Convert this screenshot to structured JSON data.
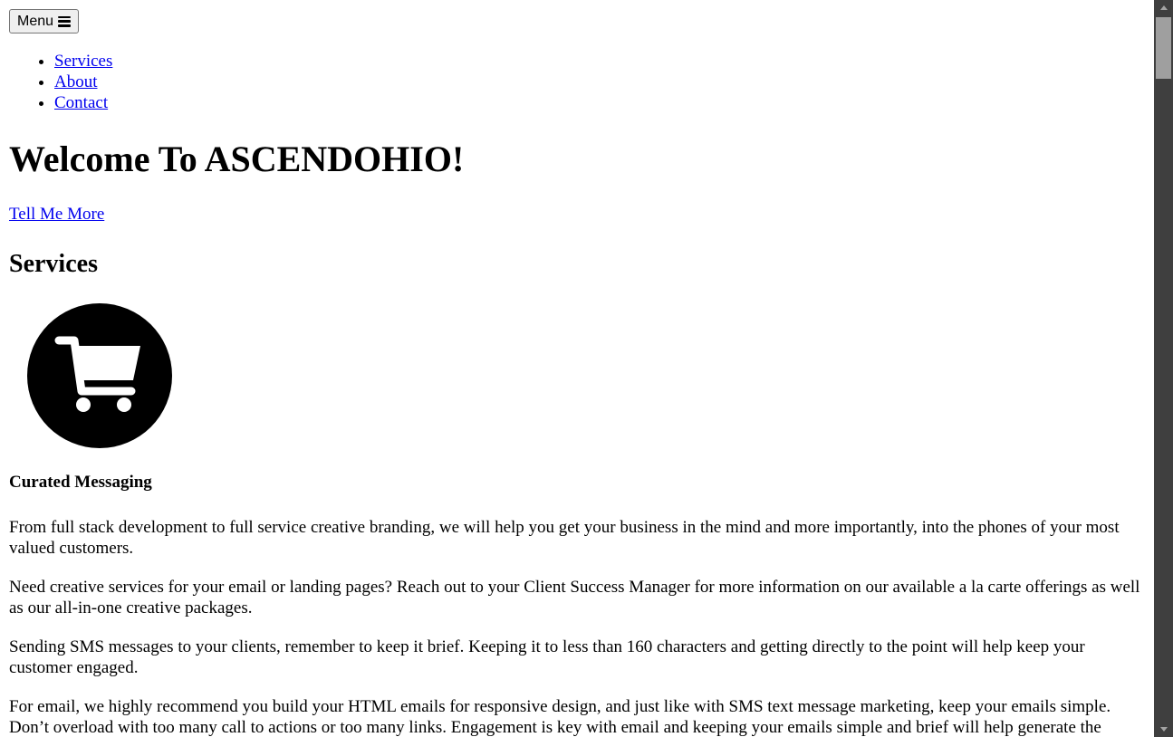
{
  "header": {
    "menu_label": "Menu"
  },
  "nav": {
    "items": [
      {
        "label": "Services"
      },
      {
        "label": "About"
      },
      {
        "label": "Contact"
      }
    ]
  },
  "hero": {
    "title": "Welcome To ASCENDOHIO!",
    "cta": "Tell Me More"
  },
  "services": {
    "heading": "Services",
    "icon": "shopping-cart-icon",
    "item_title": "Curated Messaging",
    "paragraphs": [
      "From full stack development to full service creative branding, we will help you get your business in the mind and more importantly, into the phones of your most valued customers.",
      "Need creative services for your email or landing pages? Reach out to your Client Success Manager for more information on our available a la carte offerings as well as our all-in-one creative packages.",
      "Sending SMS messages to your clients, remember to keep it brief. Keeping it to less than 160 characters and getting directly to the point will help keep your customer engaged.",
      "For email, we highly recommend you build your HTML emails for responsive design, and just like with SMS text message marketing, keep your emails simple. Don’t overload with too many call to actions or too many links. Engagement is key with email and keeping your emails simple and brief will help generate the"
    ]
  },
  "colors": {
    "link": "#0000ee",
    "scrollbar_track": "#3f3f3f",
    "scrollbar_thumb": "#9f9f9f"
  }
}
